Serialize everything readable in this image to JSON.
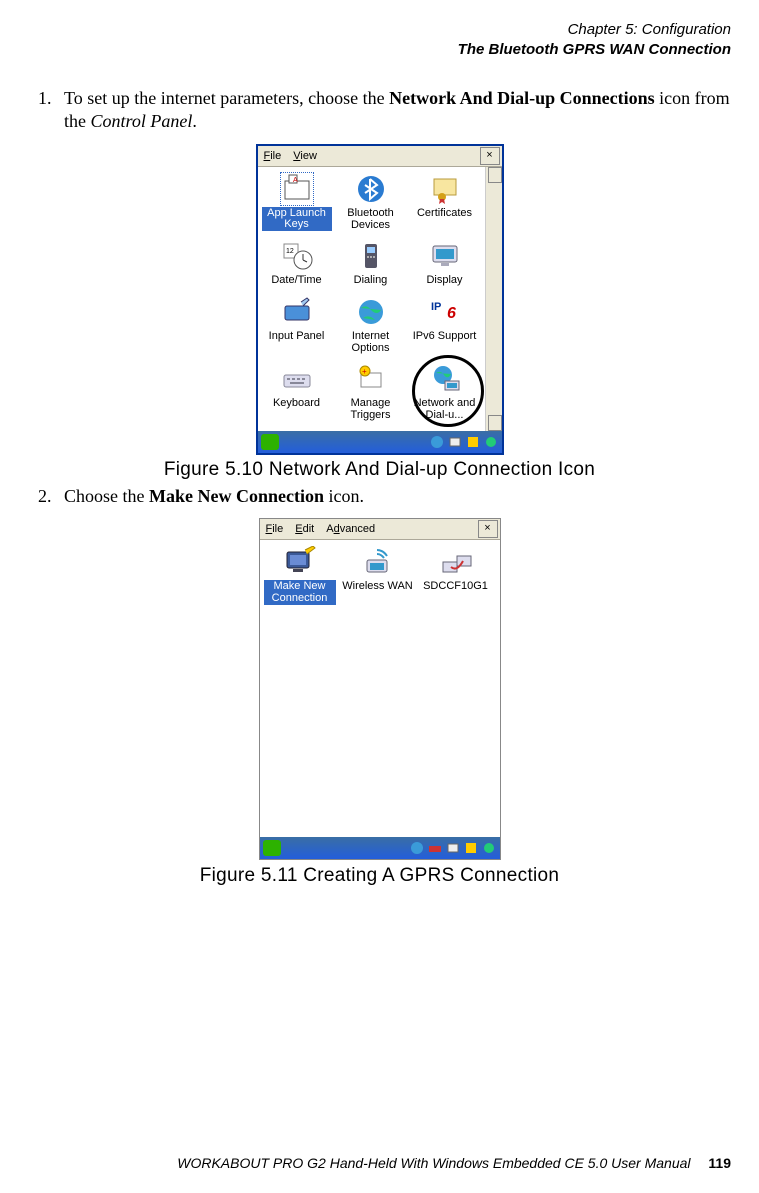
{
  "header": {
    "chapter": "Chapter 5: Configuration",
    "section": "The Bluetooth GPRS WAN Connection"
  },
  "steps": {
    "s1_a": "To set up the internet parameters, choose the ",
    "s1_b": "Network And Dial-up Connections",
    "s1_c": " icon from the ",
    "s1_d": "Control Panel",
    "s1_e": ".",
    "s2_a": "Choose the ",
    "s2_b": "Make New Connection",
    "s2_c": " icon."
  },
  "fig1": {
    "caption": "Figure 5.10 Network And Dial-up Connection Icon",
    "menu_file": "File",
    "menu_view": "View",
    "close": "×",
    "items": [
      {
        "label": "App Launch Keys",
        "selected": true
      },
      {
        "label": "Bluetooth Devices"
      },
      {
        "label": "Certificates"
      },
      {
        "label": "Date/Time"
      },
      {
        "label": "Dialing"
      },
      {
        "label": "Display"
      },
      {
        "label": "Input Panel"
      },
      {
        "label": "Internet Options"
      },
      {
        "label": "IPv6 Support"
      },
      {
        "label": "Keyboard"
      },
      {
        "label": "Manage Triggers"
      },
      {
        "label": "Network and Dial-u..."
      }
    ]
  },
  "fig2": {
    "caption": "Figure 5.11 Creating A GPRS Connection",
    "menu_file": "File",
    "menu_edit": "Edit",
    "menu_adv": "Advanced",
    "close": "×",
    "items": [
      {
        "label": "Make New Connection",
        "selected": true
      },
      {
        "label": "Wireless WAN"
      },
      {
        "label": "SDCCF10G1"
      }
    ]
  },
  "footer": {
    "text": "WORKABOUT PRO G2 Hand-Held With Windows Embedded CE 5.0 User Manual",
    "page": "119"
  }
}
